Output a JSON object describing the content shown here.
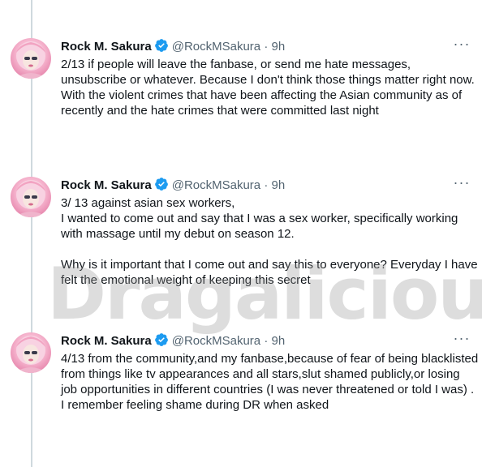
{
  "thread": {
    "tweets": [
      {
        "name": "Rock M. Sakura",
        "handle": "@RockMSakura",
        "separator": "·",
        "time": "9h",
        "more": "···",
        "paragraphs": [
          "2/13 if people will leave the fanbase, or send me hate messages, unsubscribe or whatever. Because I don't think those things matter right now.",
          "With the violent crimes that have been affecting the Asian community as of recently and the hate crimes that were committed last night"
        ]
      },
      {
        "name": "Rock M. Sakura",
        "handle": "@RockMSakura",
        "separator": "·",
        "time": "9h",
        "more": "···",
        "paragraphs": [
          "3/ 13 against asian sex workers,",
          "I wanted to come out and say that I was a sex worker, specifically working with massage until my debut on season 12.",
          "Why is it important that I come out and say this to everyone? Everyday I have felt the emotional weight of keeping this secret"
        ]
      },
      {
        "name": "Rock M. Sakura",
        "handle": "@RockMSakura",
        "separator": "·",
        "time": "9h",
        "more": "···",
        "paragraphs": [
          "4/13 from the community,and my fanbase,because of fear of being blacklisted from things like tv appearances and all stars,slut shamed publicly,or losing job opportunities in different countries (I was never threatened or told I was) . I remember feeling shame during DR when asked"
        ]
      }
    ]
  },
  "watermark": "Dragalicious",
  "colors": {
    "verified": "#1d9bf0",
    "secondary_text": "#536471",
    "thread_line": "#cfd9de"
  },
  "icons": {
    "verified": "verified-badge-icon",
    "more": "more-options-icon"
  }
}
